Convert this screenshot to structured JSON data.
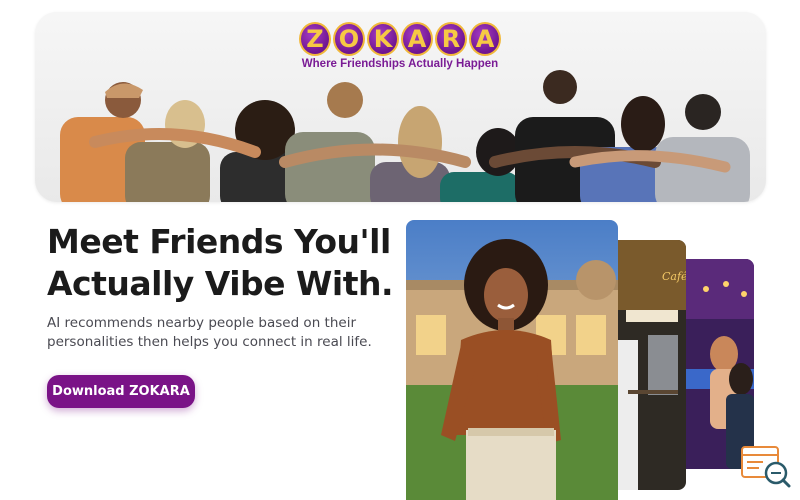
{
  "brand": {
    "logo_letters": [
      "Z",
      "O",
      "K",
      "A",
      "R",
      "A"
    ],
    "tagline": "Where Friendships Actually Happen",
    "colors": {
      "primary": "#7a1387",
      "logo_ring": "#f1b83a",
      "logo_fill": "#6f1590"
    }
  },
  "hero": {
    "headline_line1": "Meet Friends You'll",
    "headline_line2": "Actually Vibe With.",
    "subcopy_line1": "AI recommends nearby people based on their",
    "subcopy_line2": "personalities then helps you connect in real life.",
    "cta_label": "Download ZOKARA"
  },
  "icons": {
    "widget": "review-search-icon"
  }
}
